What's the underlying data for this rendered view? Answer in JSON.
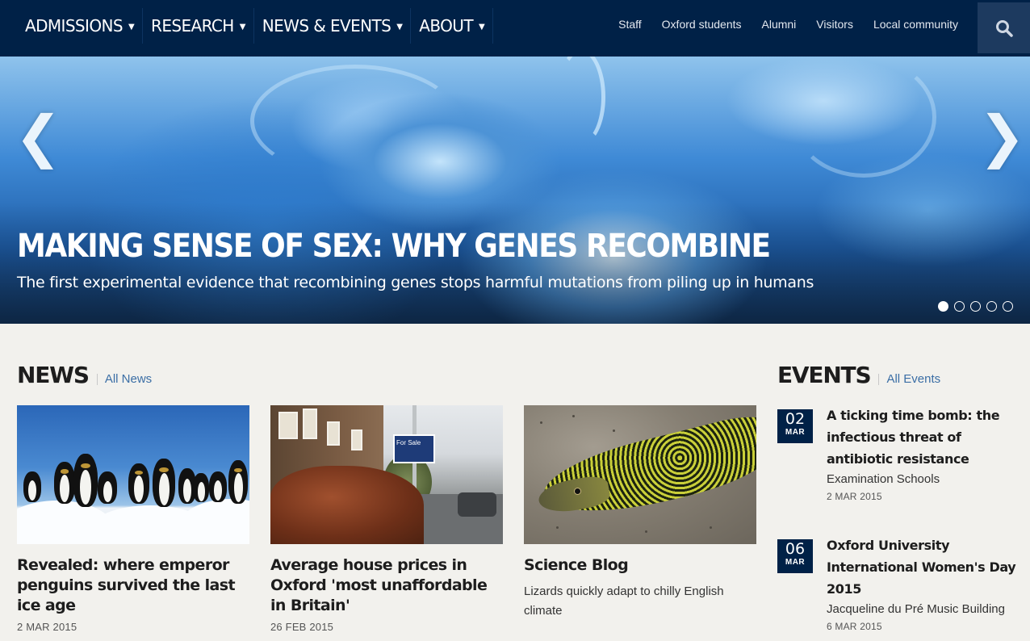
{
  "nav": {
    "main": [
      {
        "label": "ADMISSIONS"
      },
      {
        "label": "RESEARCH"
      },
      {
        "label": "NEWS & EVENTS"
      },
      {
        "label": "ABOUT"
      }
    ],
    "audience": [
      "Staff",
      "Oxford students",
      "Alumni",
      "Visitors",
      "Local community"
    ],
    "search_icon": "search-icon"
  },
  "hero": {
    "title": "MAKING SENSE OF SEX: WHY GENES RECOMBINE",
    "subtitle": "The first experimental evidence that recombining genes stops harmful mutations from piling up in humans",
    "prev_arrow": "❮",
    "next_arrow": "❯",
    "slide_count": 5,
    "active_slide": 1
  },
  "news": {
    "title": "NEWS",
    "all_link": "All News",
    "items": [
      {
        "headline": "Revealed: where emperor penguins survived the last ice age",
        "date": "2 MAR 2015"
      },
      {
        "headline": "Average house prices in Oxford 'most unaffordable in Britain'",
        "date": "26 FEB 2015",
        "sign_text": "For Sale"
      },
      {
        "headline": "Science Blog",
        "description": "Lizards quickly adapt to chilly English climate"
      }
    ]
  },
  "events": {
    "title": "EVENTS",
    "all_link": "All Events",
    "items": [
      {
        "day": "02",
        "month": "MAR",
        "title": "A ticking time bomb: the infectious threat of antibiotic resistance",
        "venue": "Examination Schools",
        "date": "2 MAR 2015"
      },
      {
        "day": "06",
        "month": "MAR",
        "title": "Oxford University International Women's Day 2015",
        "venue": "Jacqueline du Pré Music Building",
        "date": "6 MAR 2015"
      }
    ]
  },
  "colors": {
    "brand_navy": "#002147",
    "link_blue": "#3b6ea5",
    "page_bg": "#f2f1ed"
  }
}
